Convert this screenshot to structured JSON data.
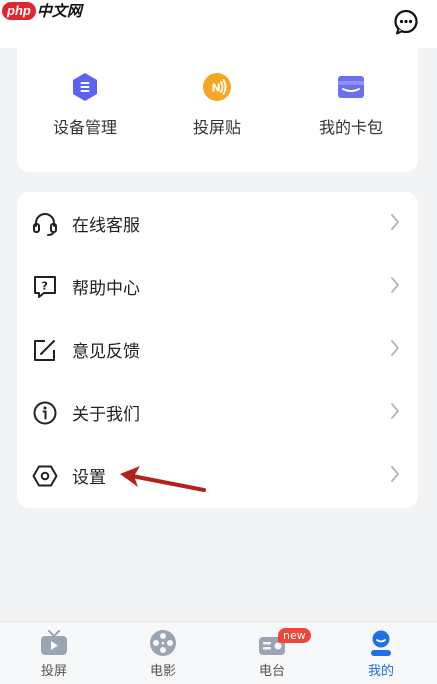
{
  "watermark": {
    "php": "php",
    "cn": "中文网"
  },
  "quick_actions": [
    {
      "label": "设备管理",
      "icon": "hexagon-list-icon",
      "color": "#5b63f0"
    },
    {
      "label": "投屏贴",
      "icon": "nfc-icon",
      "color": "#f5a623"
    },
    {
      "label": "我的卡包",
      "icon": "wallet-icon",
      "color": "#6b6ff2"
    }
  ],
  "menu": [
    {
      "label": "在线客服",
      "icon": "headset-icon"
    },
    {
      "label": "帮助中心",
      "icon": "help-icon"
    },
    {
      "label": "意见反馈",
      "icon": "feedback-edit-icon"
    },
    {
      "label": "关于我们",
      "icon": "info-icon"
    },
    {
      "label": "设置",
      "icon": "settings-hexagon-icon"
    }
  ],
  "tabs": [
    {
      "label": "投屏",
      "icon": "tv-icon"
    },
    {
      "label": "电影",
      "icon": "film-reel-icon"
    },
    {
      "label": "电台",
      "icon": "radio-icon",
      "badge": "new"
    },
    {
      "label": "我的",
      "icon": "profile-icon",
      "active": true
    }
  ],
  "colors": {
    "accent": "#1f6fe6",
    "badge": "#f0473c",
    "arrow": "#b3211c"
  }
}
